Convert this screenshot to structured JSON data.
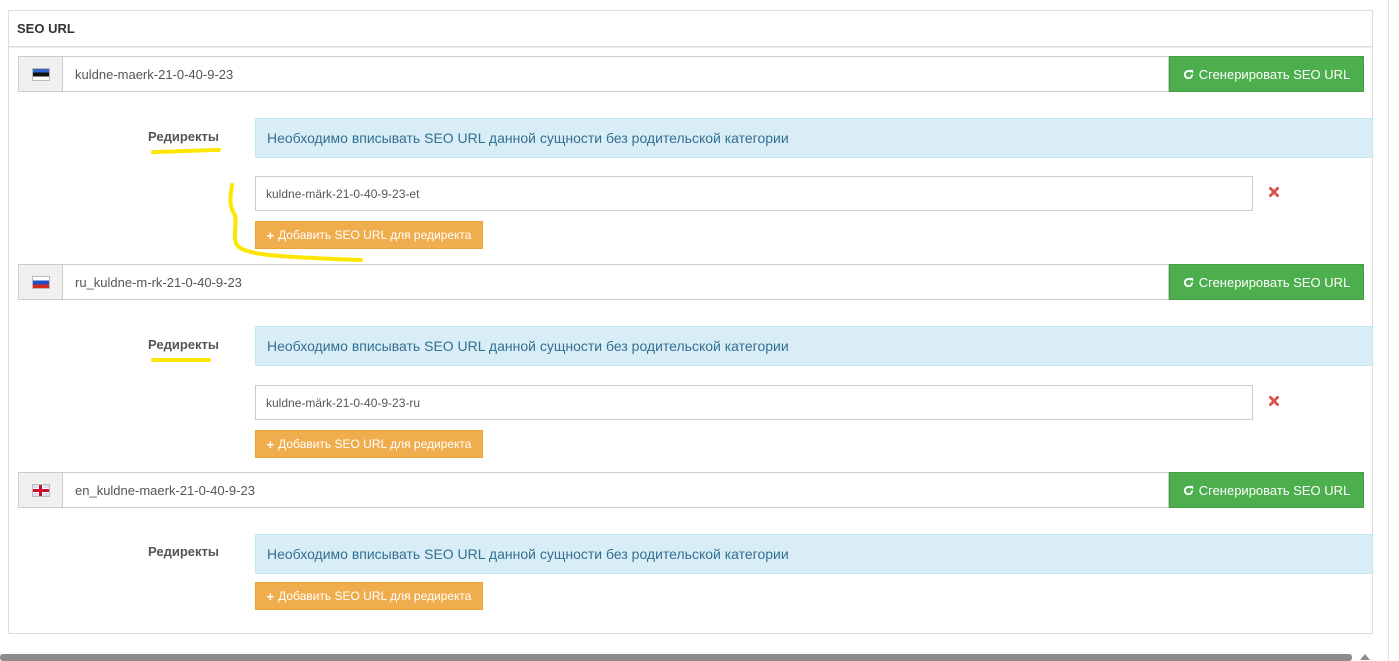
{
  "panel": {
    "title": "SEO URL"
  },
  "generate_label": "Сгенерировать SEO URL",
  "redirects_label": "Редиректы",
  "info_text": "Необходимо вписывать SEO URL данной сущности без родительской категории",
  "add_redirect_label": "Добавить SEO URL для редиректа",
  "languages": [
    {
      "code": "et",
      "flag": "estonia-flag-icon",
      "seo_url": "kuldne-maerk-21-0-40-9-23",
      "redirect": "kuldne-märk-21-0-40-9-23-et"
    },
    {
      "code": "ru",
      "flag": "russia-flag-icon",
      "seo_url": "ru_kuldne-m-rk-21-0-40-9-23",
      "redirect": "kuldne-märk-21-0-40-9-23-ru"
    },
    {
      "code": "en",
      "flag": "uk-flag-icon",
      "seo_url": "en_kuldne-maerk-21-0-40-9-23",
      "redirect": ""
    }
  ],
  "colors": {
    "generate_button": "#4cae4c",
    "add_button": "#f0ad4e",
    "info_background": "#d9edf7",
    "remove_icon": "#d9534f",
    "highlight": "#ffe600"
  }
}
